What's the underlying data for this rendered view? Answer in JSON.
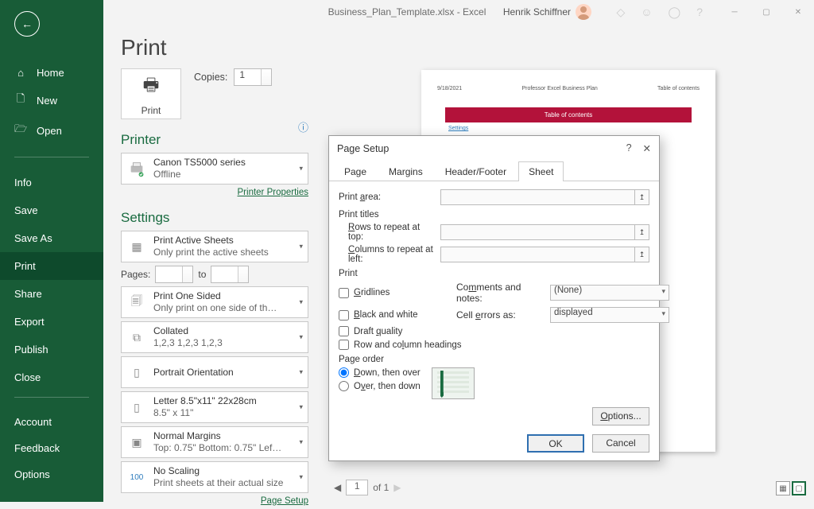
{
  "titlebar": {
    "doc_title": "Business_Plan_Template.xlsx - Excel",
    "user": "Henrik Schiffner"
  },
  "sidebar": {
    "home": "Home",
    "new": "New",
    "open": "Open",
    "info": "Info",
    "save": "Save",
    "save_as": "Save As",
    "print": "Print",
    "share": "Share",
    "export": "Export",
    "publish": "Publish",
    "close": "Close",
    "account": "Account",
    "feedback": "Feedback",
    "options": "Options"
  },
  "main": {
    "heading": "Print",
    "print_btn": "Print",
    "copies_label": "Copies:",
    "copies_value": "1",
    "printer_heading": "Printer",
    "printer_name": "Canon TS5000 series",
    "printer_status": "Offline",
    "printer_props": "Printer Properties",
    "settings_heading": "Settings",
    "active_sheets": {
      "title": "Print Active Sheets",
      "sub": "Only print the active sheets"
    },
    "pages_label": "Pages:",
    "pages_to": "to",
    "one_sided": {
      "title": "Print One Sided",
      "sub": "Only print on one side of th…"
    },
    "collated": {
      "title": "Collated",
      "sub": "1,2,3   1,2,3   1,2,3"
    },
    "orientation": {
      "title": "Portrait Orientation",
      "sub": ""
    },
    "paper": {
      "title": "Letter 8.5\"x11\" 22x28cm",
      "sub": "8.5\" x 11\""
    },
    "margins": {
      "title": "Normal Margins",
      "sub": "Top: 0.75\" Bottom: 0.75\" Lef…"
    },
    "scaling": {
      "title": "No Scaling",
      "sub": "Print sheets at their actual size"
    },
    "page_setup": "Page Setup",
    "pager_current": "1",
    "pager_total": "of  1"
  },
  "preview": {
    "date": "9/18/2021",
    "center": "Professor Excel Business Plan",
    "right": "Table of contents",
    "title": "Table of contents",
    "link": "Settings"
  },
  "dialog": {
    "title": "Page Setup",
    "tab_page": "Page",
    "tab_margins": "Margins",
    "tab_header": "Header/Footer",
    "tab_sheet": "Sheet",
    "print_area_label": "Print area:",
    "print_titles_label": "Print titles",
    "rows_repeat": "Rows to repeat at top:",
    "cols_repeat": "Columns to repeat at left:",
    "print_group": "Print",
    "gridlines": "Gridlines",
    "bw": "Black and white",
    "draft": "Draft quality",
    "rowcol": "Row and column headings",
    "comments_label": "Comments and notes:",
    "comments_value": "(None)",
    "errors_label": "Cell errors as:",
    "errors_value": "displayed",
    "page_order": "Page order",
    "down_over": "Down, then over",
    "over_down": "Over, then down",
    "options": "Options...",
    "ok": "OK",
    "cancel": "Cancel"
  }
}
